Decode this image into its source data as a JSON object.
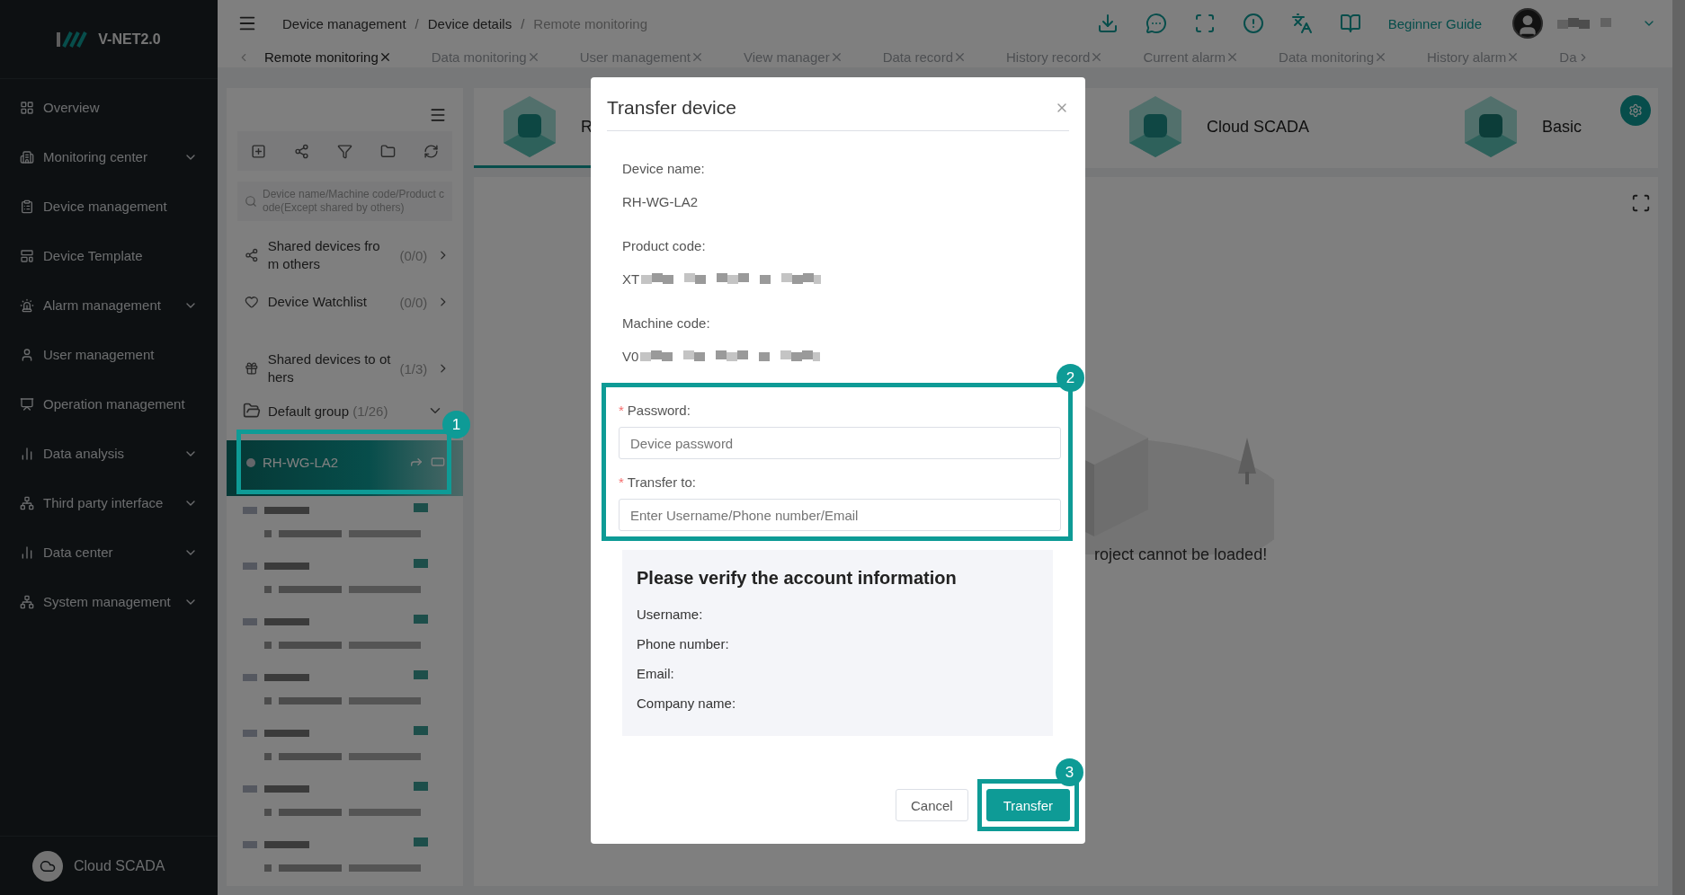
{
  "sidebar": {
    "logo": "V-NET2.0",
    "items": [
      {
        "label": "Overview",
        "has_submenu": false
      },
      {
        "label": "Monitoring center",
        "has_submenu": true
      },
      {
        "label": "Device management",
        "has_submenu": false
      },
      {
        "label": "Device Template",
        "has_submenu": false
      },
      {
        "label": "Alarm management",
        "has_submenu": true
      },
      {
        "label": "User management",
        "has_submenu": false
      },
      {
        "label": "Operation management",
        "has_submenu": false
      },
      {
        "label": "Data analysis",
        "has_submenu": true
      },
      {
        "label": "Third party interface",
        "has_submenu": true
      },
      {
        "label": "Data center",
        "has_submenu": true
      },
      {
        "label": "System management",
        "has_submenu": true
      }
    ],
    "footer": "Cloud SCADA"
  },
  "header": {
    "breadcrumb": [
      {
        "label": "Device management",
        "current": false
      },
      {
        "separator": "/",
        "label": "Device details",
        "current": false
      },
      {
        "separator": "/",
        "label": "Remote monitoring",
        "current": true
      }
    ],
    "guide": "Beginner Guide",
    "tabs": [
      {
        "label": "Remote monitoring",
        "selected": true
      },
      {
        "label": "Data monitoring",
        "selected": false
      },
      {
        "label": "User management",
        "selected": false
      },
      {
        "label": "View manager",
        "selected": false
      },
      {
        "label": "Data record",
        "selected": false
      },
      {
        "label": "History record",
        "selected": false
      },
      {
        "label": "Current alarm",
        "selected": false
      },
      {
        "label": "Data monitoring",
        "selected": false
      },
      {
        "label": "History alarm",
        "selected": false
      },
      {
        "label": "Da",
        "selected": false
      }
    ]
  },
  "device_panel": {
    "search": {
      "placeholder": "Device name/Machine code/Product code(Except shared by others)"
    },
    "entries": [
      {
        "label": "Shared devices from others",
        "count": "(0/0)"
      },
      {
        "label": "Device Watchlist",
        "count": "(0/0)"
      },
      {
        "label": "Shared devices to others",
        "count": "(1/3)"
      }
    ],
    "group": {
      "label": "Default group",
      "count": "(1/26)",
      "expanded": true
    },
    "devices": [
      {
        "kind": "device",
        "name": "RH-WG-LA2",
        "selected": true
      },
      {
        "kind": "redacted",
        "selected": false
      },
      {
        "kind": "redacted",
        "selected": false
      },
      {
        "kind": "redacted",
        "selected": false
      },
      {
        "kind": "redacted",
        "selected": false
      },
      {
        "kind": "redacted",
        "selected": false
      },
      {
        "kind": "redacted",
        "selected": false
      },
      {
        "kind": "redacted",
        "selected": false
      }
    ]
  },
  "app_tabs": [
    {
      "label": "R",
      "selected": true
    },
    {
      "label": "Cloud SCADA",
      "selected": false
    },
    {
      "label": "Basic",
      "selected": false
    }
  ],
  "empty_message": "roject cannot be loaded!",
  "dialog": {
    "title": "Transfer device",
    "fields": [
      {
        "label": "Device name:",
        "value": "RH-WG-LA2",
        "redacted": false
      },
      {
        "label": "Product code:",
        "value": "XT",
        "redacted": true
      },
      {
        "label": "Machine code:",
        "value": "V0",
        "redacted": true
      }
    ],
    "inputs": [
      {
        "label": "Password:",
        "required_mark": "*",
        "placeholder": "Device password"
      },
      {
        "label": "Transfer to:",
        "required_mark": "*",
        "placeholder": "Enter Username/Phone number/Email"
      }
    ],
    "verify": {
      "title": "Please verify the account information",
      "lines": [
        "Username:",
        "Phone number:",
        "Email:",
        "Company name:"
      ]
    },
    "buttons": [
      {
        "label": "Cancel",
        "kind": "secondary"
      },
      {
        "label": "Transfer",
        "kind": "primary"
      }
    ]
  },
  "callouts": [
    "1",
    "2",
    "3"
  ]
}
